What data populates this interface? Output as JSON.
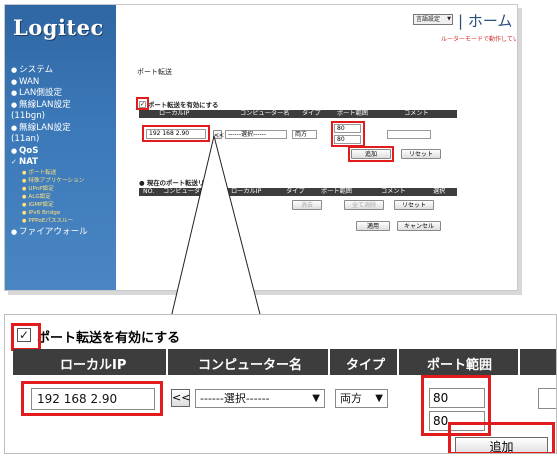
{
  "brand": {
    "logo": "Logitec"
  },
  "header": {
    "language_select": "言語設定",
    "home_link": "| ホーム |",
    "router_mode_notice": "ルーターモードで動作しています。"
  },
  "sidebar": {
    "items": [
      {
        "label": "システム"
      },
      {
        "label": "WAN"
      },
      {
        "label": "LAN側設定"
      },
      {
        "label": "無線LAN設定 (11bgn)"
      },
      {
        "label": "無線LAN設定 (11an)"
      },
      {
        "label": "QoS"
      },
      {
        "label": "NAT"
      },
      {
        "label": "ファイアウォール"
      }
    ],
    "nat_subitems": [
      "ポート転送",
      "特殊アプリケーション",
      "UPnP設定",
      "ALG設定",
      "IGMP設定",
      "IPv6 Bridge",
      "PPPoEパススルー"
    ]
  },
  "page": {
    "title": "ポート転送",
    "enable_checkbox_label": "ポート転送を有効にする",
    "enable_checked": true,
    "columns": [
      "ローカルIP",
      "コンピューター名",
      "タイプ",
      "ポート範囲",
      "コメント"
    ],
    "form": {
      "local_ip": "192 168 2.90",
      "move_button": "<<",
      "computer_select": "------選択------",
      "type_select": "両方",
      "port_start": "80",
      "port_end": "80",
      "comment": ""
    },
    "add_button": "追加",
    "reset_button": "リセット",
    "current_list_title": "現在のポート転送リスト",
    "list_columns": [
      "NO.",
      "コンピューター名",
      "ローカルIP",
      "タイプ",
      "ポート範囲",
      "コメント",
      "選択"
    ],
    "delete_button": "消去",
    "delete_all_button": "全て消除",
    "list_reset_button": "リセット",
    "apply_button": "適用",
    "cancel_button": "キャンセル"
  },
  "colors": {
    "sidebar": "#3b78b8",
    "table_header": "#3d3d3d",
    "highlight": "#e21c1c",
    "submenu": "#ffe27a"
  }
}
